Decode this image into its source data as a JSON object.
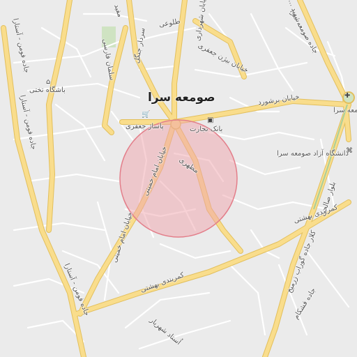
{
  "map": {
    "city_label": "صومعه سرا",
    "colors": {
      "background": "#ebebeb",
      "minor_road": "#ffffff",
      "major_road_fill": "#f9dd8c",
      "major_road_casing": "#e2bf5c",
      "park": "#cfe3c2",
      "circle_fill": "#f0a3ac",
      "circle_stroke": "#e37e8a"
    },
    "highlight_circle": {
      "shape": "circle"
    },
    "pois": [
      {
        "name": "باشگاه تختی",
        "icon": "home-sport-icon"
      },
      {
        "name": "پاساژ جعفری",
        "icon": "shopping-cart-icon"
      },
      {
        "name": "بانک تجارت",
        "icon": "bank-atm-icon"
      },
      {
        "name": "دانشگاه آزاد صومعه سرا",
        "icon": "university-icon"
      },
      {
        "name": "صومعه سرا",
        "icon": "roundabout-icon"
      }
    ],
    "street_labels": [
      "طلوعی",
      "خیابان بیژن جعفری",
      "خیابان برشورد",
      "کمربندی بهشتی",
      "کمربندی بهشتی",
      "خیابان امام خمینی",
      "خیابان امام خمینی",
      "مطهری",
      "جاده فومن - آستارا",
      "جاده فومن - آستارا",
      "جاده فومن - آستارا",
      "اُستاد شهریار",
      "جاده فشکام",
      "کلار جاده گوراب زرمیخ",
      "بلوار صالحی",
      "جاده صومعه سرا",
      "سردار جنگل",
      "خیابان شهرداری",
      "سلمان فارسی",
      "مفید",
      "شهید ..."
    ]
  }
}
